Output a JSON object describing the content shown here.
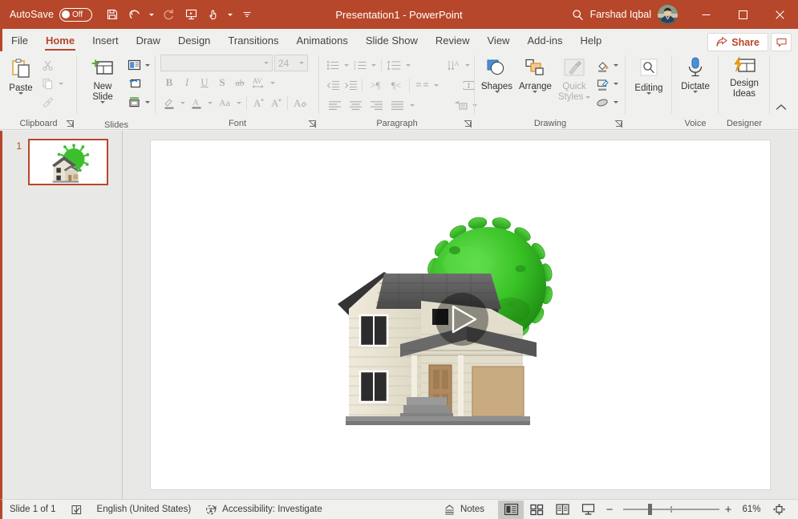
{
  "titlebar": {
    "autosave_label": "AutoSave",
    "autosave_state": "Off",
    "document_title": "Presentation1  -  PowerPoint",
    "user_name": "Farshad Iqbal",
    "qat": [
      {
        "name": "save",
        "icon": "save-icon"
      },
      {
        "name": "undo",
        "icon": "undo-icon"
      },
      {
        "name": "redo",
        "icon": "redo-icon"
      },
      {
        "name": "start-from-beginning",
        "icon": "present-icon"
      },
      {
        "name": "touch-mouse-mode",
        "icon": "touch-mode-icon"
      },
      {
        "name": "customize-quick-access-toolbar",
        "icon": "more-icon"
      }
    ],
    "search_icon": "search-icon",
    "window": {
      "minimize": "minimize-icon",
      "restore": "restore-icon",
      "close": "close-icon"
    }
  },
  "tabs": [
    {
      "label": "File",
      "active": false
    },
    {
      "label": "Home",
      "active": true
    },
    {
      "label": "Insert",
      "active": false
    },
    {
      "label": "Draw",
      "active": false
    },
    {
      "label": "Design",
      "active": false
    },
    {
      "label": "Transitions",
      "active": false
    },
    {
      "label": "Animations",
      "active": false
    },
    {
      "label": "Slide Show",
      "active": false
    },
    {
      "label": "Review",
      "active": false
    },
    {
      "label": "View",
      "active": false
    },
    {
      "label": "Add-ins",
      "active": false
    },
    {
      "label": "Help",
      "active": false
    }
  ],
  "tab_actions": {
    "share_label": "Share",
    "share_icon": "share-icon",
    "comments_icon": "comment-icon"
  },
  "ribbon": {
    "groups": [
      {
        "name": "clipboard",
        "label": "Clipboard",
        "has_dialog_launcher": true,
        "items": [
          {
            "name": "paste",
            "label": "Paste",
            "icon": "paste-icon",
            "disabled": false
          },
          {
            "name": "cut",
            "label": "Cut",
            "icon": "scissors-icon",
            "disabled": true
          },
          {
            "name": "copy",
            "label": "Copy",
            "icon": "copy-icon",
            "disabled": true
          },
          {
            "name": "format-painter",
            "label": "Format Painter",
            "icon": "brush-icon",
            "disabled": true
          }
        ]
      },
      {
        "name": "slides",
        "label": "Slides",
        "has_dialog_launcher": false,
        "items": [
          {
            "name": "new-slide",
            "label": "New Slide",
            "icon": "new-slide-icon",
            "disabled": false
          },
          {
            "name": "layout",
            "label": "Layout",
            "icon": "layout-icon",
            "disabled": false
          },
          {
            "name": "reset",
            "label": "Reset",
            "icon": "reset-icon",
            "disabled": false
          },
          {
            "name": "section",
            "label": "Section",
            "icon": "section-icon",
            "disabled": false
          }
        ]
      },
      {
        "name": "font",
        "label": "Font",
        "has_dialog_launcher": true,
        "font_name_value": "",
        "font_size_value": "24",
        "items": [
          {
            "name": "bold",
            "label": "B",
            "disabled": true
          },
          {
            "name": "italic",
            "label": "I",
            "disabled": true
          },
          {
            "name": "underline",
            "label": "U",
            "disabled": true
          },
          {
            "name": "text-shadow",
            "label": "S",
            "disabled": true
          },
          {
            "name": "strikethrough",
            "label": "ab",
            "disabled": true
          },
          {
            "name": "character-spacing",
            "label": "AV",
            "disabled": true
          },
          {
            "name": "text-highlight-color",
            "label": "Text Highlight Color",
            "disabled": true
          },
          {
            "name": "font-color",
            "label": "Font Color",
            "disabled": true
          },
          {
            "name": "change-case",
            "label": "Aa",
            "disabled": true
          },
          {
            "name": "increase-font-size",
            "label": "A",
            "disabled": true
          },
          {
            "name": "decrease-font-size",
            "label": "A",
            "disabled": true
          },
          {
            "name": "clear-formatting",
            "label": "Clear All Formatting",
            "disabled": true
          }
        ]
      },
      {
        "name": "paragraph",
        "label": "Paragraph",
        "has_dialog_launcher": true,
        "items": [
          {
            "name": "bullets",
            "disabled": true
          },
          {
            "name": "numbering",
            "disabled": true
          },
          {
            "name": "line-spacing",
            "disabled": true
          },
          {
            "name": "text-direction",
            "disabled": true
          },
          {
            "name": "decrease-indent",
            "disabled": true
          },
          {
            "name": "increase-indent",
            "disabled": true
          },
          {
            "name": "ltr-text-direction",
            "disabled": true
          },
          {
            "name": "rtl-text-direction",
            "disabled": true
          },
          {
            "name": "columns",
            "disabled": true
          },
          {
            "name": "align-text",
            "disabled": true
          },
          {
            "name": "align-left",
            "disabled": true
          },
          {
            "name": "center",
            "disabled": true
          },
          {
            "name": "align-right",
            "disabled": true
          },
          {
            "name": "justify",
            "disabled": true
          },
          {
            "name": "convert-to-smartart",
            "disabled": true
          }
        ]
      },
      {
        "name": "drawing",
        "label": "Drawing",
        "has_dialog_launcher": true,
        "items": [
          {
            "name": "shapes",
            "label": "Shapes",
            "disabled": false
          },
          {
            "name": "arrange",
            "label": "Arrange",
            "disabled": false
          },
          {
            "name": "quick-styles",
            "label": "Quick Styles",
            "disabled": true
          },
          {
            "name": "shape-fill",
            "label": "Shape Fill",
            "disabled": false
          },
          {
            "name": "shape-outline",
            "label": "Shape Outline",
            "disabled": false
          },
          {
            "name": "shape-effects",
            "label": "Shape Effects",
            "disabled": false
          }
        ]
      },
      {
        "name": "editing",
        "label": "",
        "has_dialog_launcher": false,
        "items": [
          {
            "name": "editing",
            "label": "Editing",
            "disabled": false
          }
        ]
      },
      {
        "name": "voice",
        "label": "Voice",
        "has_dialog_launcher": false,
        "items": [
          {
            "name": "dictate",
            "label": "Dictate",
            "disabled": false
          }
        ]
      },
      {
        "name": "designer",
        "label": "Designer",
        "has_dialog_launcher": false,
        "items": [
          {
            "name": "design-ideas",
            "label": "Design Ideas",
            "label_line1": "Design",
            "label_line2": "Ideas",
            "disabled": false
          }
        ]
      }
    ],
    "collapse_icon": "chevron-up-icon"
  },
  "thumbnails": {
    "slides": [
      {
        "number": "1",
        "selected": true
      }
    ]
  },
  "slide": {
    "media": {
      "name": "house-virus-video",
      "play_overlay_icon": "play-icon",
      "description": "3D illustration of a two-story house with a green virus sphere behind it"
    }
  },
  "statusbar": {
    "slide_count_label": "Slide 1 of 1",
    "notes_icon": "notes-icon",
    "language": "English (United States)",
    "accessibility_icon": "accessibility-icon",
    "accessibility_label": "Accessibility: Investigate",
    "notes_label": "Notes",
    "views": [
      {
        "name": "normal-view",
        "active": true
      },
      {
        "name": "slide-sorter-view",
        "active": false
      },
      {
        "name": "reading-view",
        "active": false
      },
      {
        "name": "slide-show-view",
        "active": false
      }
    ],
    "zoom_out_label": "−",
    "zoom_in_label": "+",
    "zoom_percent": "61%",
    "fit_slide_icon": "fit-to-window-icon"
  },
  "colors": {
    "brand": "#b7472a",
    "ribbon_bg": "#f0f0ef",
    "canvas_bg": "#e8e8e7",
    "disabled_text": "#b0b0b0"
  }
}
